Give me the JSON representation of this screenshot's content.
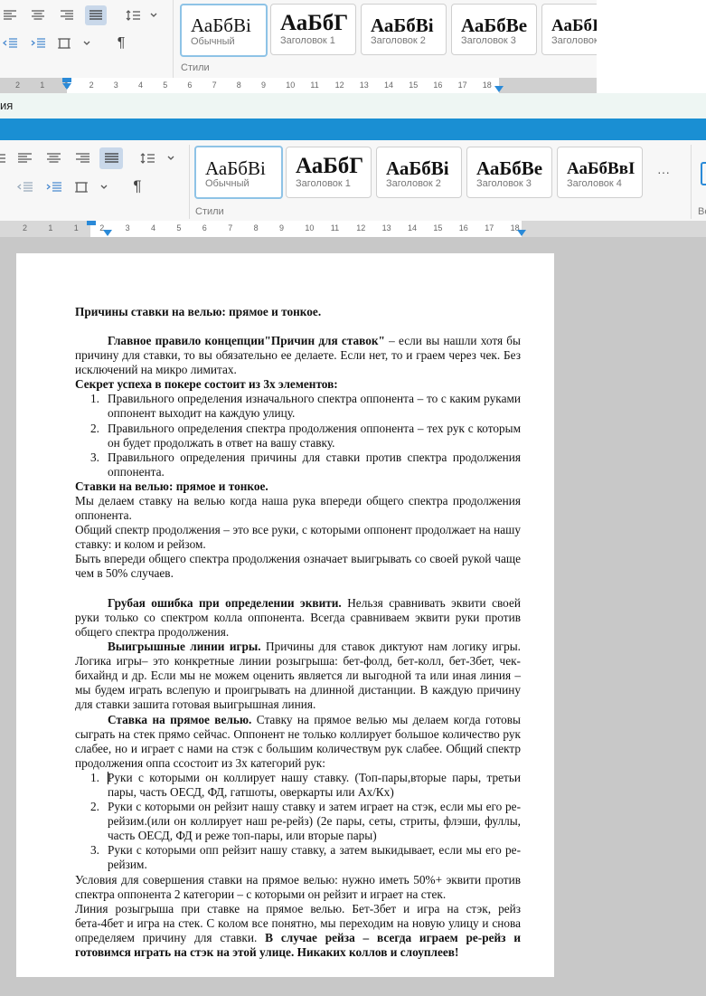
{
  "colors": {
    "accent_bar": "#1a8fd3",
    "selected_style_border": "#8ec3e6",
    "ruler_bg": "#d0d0d0",
    "workspace": "#c8c8c8",
    "status_strip": "#eef6f3"
  },
  "top_ribbon": {
    "styles_group_label": "Стили",
    "styles": [
      {
        "sample": "АаБбВі",
        "name": "Обычный"
      },
      {
        "sample": "АаБбГ",
        "name": "Заголовок 1"
      },
      {
        "sample": "АаБбВі",
        "name": "Заголовок 2"
      },
      {
        "sample": "АаБбВе",
        "name": "Заголовок 3"
      },
      {
        "sample": "АаБбІ",
        "name": "Заголовок"
      }
    ],
    "ruler_ticks": [
      "2",
      "1",
      "1",
      "2",
      "3",
      "4",
      "5",
      "6",
      "7",
      "8",
      "9",
      "10",
      "11",
      "12",
      "13",
      "14",
      "15",
      "16",
      "17",
      "18"
    ]
  },
  "status_strip": {
    "text": "ия"
  },
  "main_ribbon": {
    "styles_group_label": "Стили",
    "next_group_label": "Ве",
    "more_label": "···",
    "styles": [
      {
        "sample": "АаБбВі",
        "name": "Обычный"
      },
      {
        "sample": "АаБбГ",
        "name": "Заголовок 1"
      },
      {
        "sample": "АаБбВі",
        "name": "Заголовок 2"
      },
      {
        "sample": "АаБбВе",
        "name": "Заголовок 3"
      },
      {
        "sample": "АаБбВвІ",
        "name": "Заголовок 4"
      }
    ],
    "ruler_ticks": [
      "2",
      "1",
      "1",
      "2",
      "3",
      "4",
      "5",
      "6",
      "7",
      "8",
      "9",
      "10",
      "11",
      "12",
      "13",
      "14",
      "15",
      "16",
      "17",
      "18"
    ]
  },
  "document": {
    "title": "Причины ставки на велью: прямое и тонкое.",
    "p1_bold": "Главное правило концепции\"Причин для ставок\"",
    "p1_rest": " – если вы нашли хотя бы причину для ставки, то вы обязательно ее делаете. Если нет, то и грaем через чек. Без исключений на микро лимитах.",
    "secret_heading": "Секрет успеха в покере состоит из 3х элементов:",
    "list1": [
      "Правильного определения изначального спектра оппонента – то с каким руками оппонент выходит на каждую улицу.",
      "Правильного определения спектра продолжения оппонента – тех рук с которым он будет продолжать в ответ на вашу ставку.",
      "Правильного определения причины для ставки против спектра продолжения оппонента."
    ],
    "value_heading": "Ставки на велью: прямое и тонкое.",
    "p2": "Мы делаем ставку на велью когда наша рука впереди общего спектра продолжения оппонента.",
    "p3": "Общий спектр продолжения – это все руки, с которыми оппонент продолжает на нашу ставку: и колом и рейзом.",
    "p4": "Быть впереди общего спектра продолжения означает выигрывать со своей рукой чаще чем в 50% случаев.",
    "p5_bold": "Грубая ошибка при определении эквити.",
    "p5_rest": " Нельзя сравнивать эквити своей руки только со спектром колла оппонента. Всегда сравниваем эквити руки против общего спектра продолжения.",
    "p6_bold": "Выигрышные линии игры.",
    "p6_rest": " Причины для ставок диктуют нам логику игры. Логика игры– это конкретные линии розыгрыша: бет-фолд, бет-колл, бет-3бет, чек-бихайнд и др. Если мы не можем оценить является ли выгодной та или иная линия – мы будем играть вслепую и проигрывать на длинной дистанции. В каждую причину для ставки зашита готовая выигрышная линия.",
    "p7_bold": "Ставка на прямое велью.",
    "p7_rest": " Ставку на прямое велью мы делаем когда готовы сыграть на стек прямо сейчас. Оппонент не только коллирует большое количество рук слабее, но и играет с нами на стэк с большим количествум рук слабее. Общий спектр продолжения оппа ссостоит из 3х категорий рук:",
    "list2": [
      "Руки с которыми он коллирует нашу ставку. (Топ-пары,вторые пары, третьи пары, часть ОЕСД, ФД, гатшоты, оверкарты или Ах/Кх)",
      "Руки с которыми он рейзит нашу ставку и затем играет на стэк, если мы его ре-рейзим.(или он коллирует наш ре-рейз) (2е пары, сеты, стриты, флэши, фуллы, часть ОЕСД, ФД и реже топ-пары, или вторые пары)",
      "Руки с которыми опп рейзит нашу ставку, а затем выкидывает, если мы его ре-рейзим."
    ],
    "p8": "Условия для совершения ставки на прямое велью: нужно иметь 50%+ эквити против спектра оппонента 2 категории – с которыми он рейзит и играет на стек.",
    "p9_rest": "Линия розыгрыша при ставке на прямое велью. Бет-3бет и игра на стэк, рейз бета-4бет и игра на стек. С колом все понятно, мы переходим на новую улицу и снова определяем причину для ставки. ",
    "p9_bold": "В случае рейза – всегда играем ре-рейз и готовимся играть на стэк на этой улице. Никаких коллов и слоуплеев!"
  }
}
